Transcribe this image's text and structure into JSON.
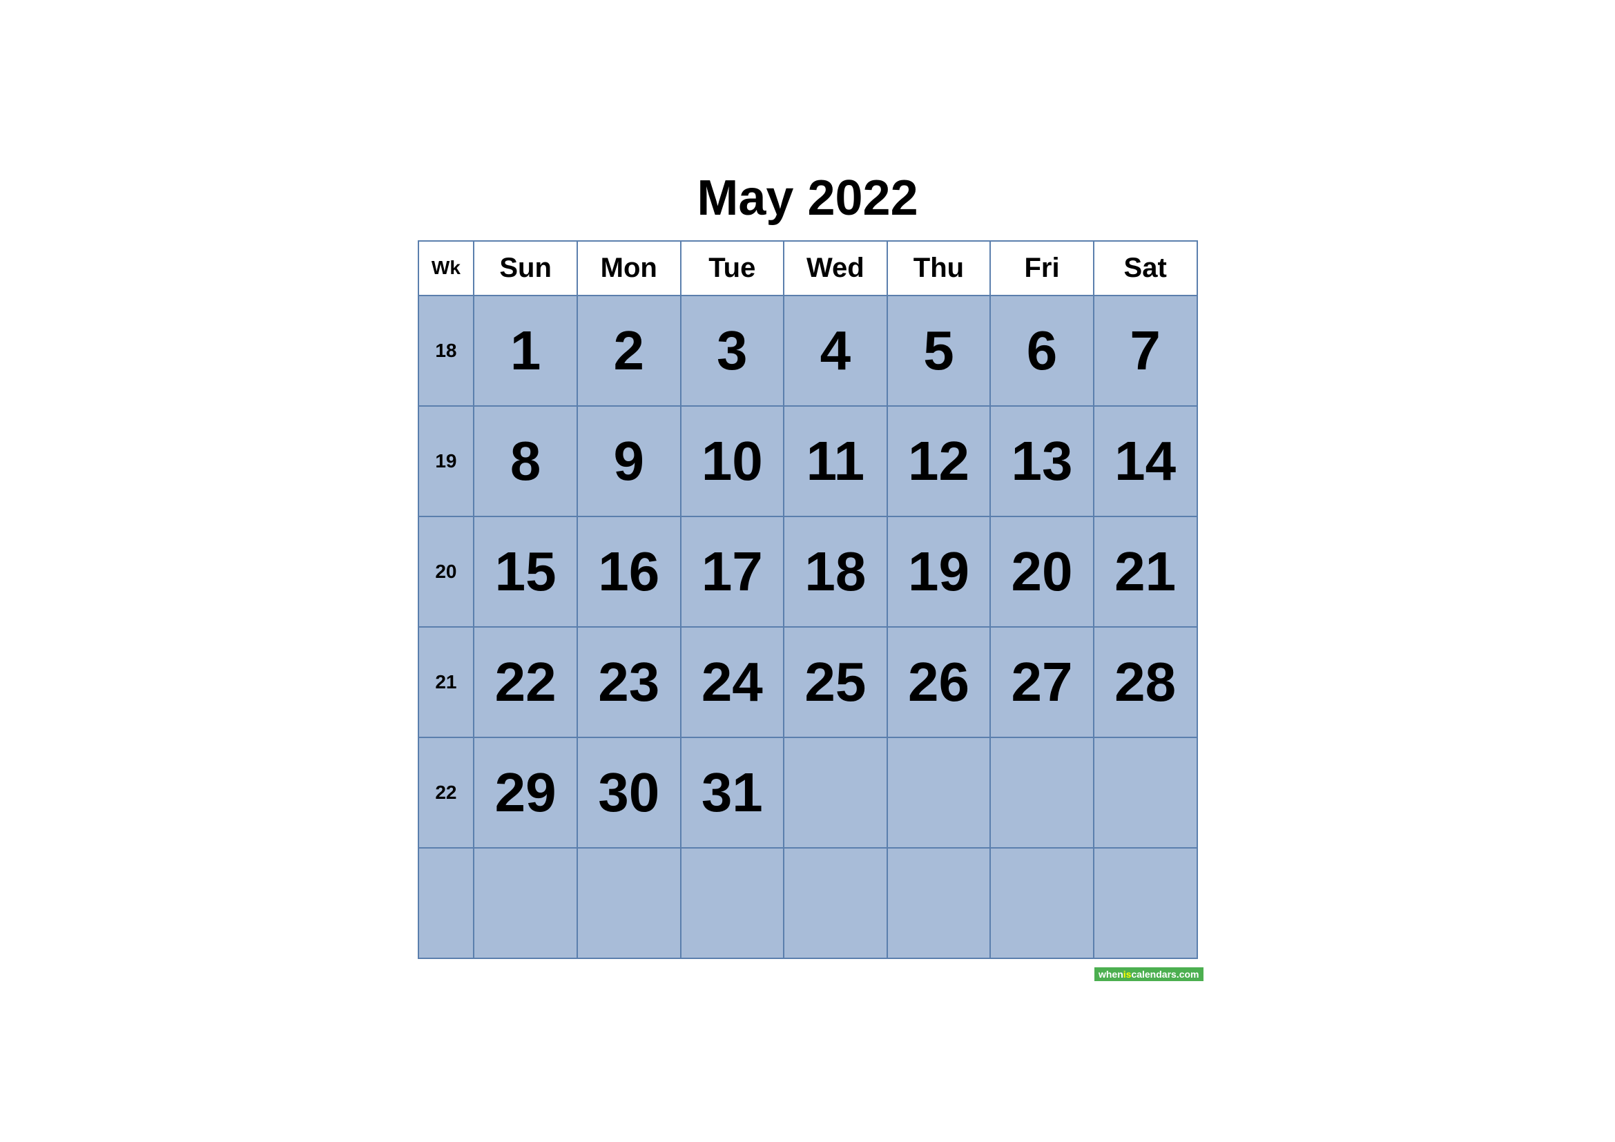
{
  "title": "May 2022",
  "colors": {
    "cell_bg": "#a8bcd8",
    "border": "#5b7fad",
    "text": "#000000",
    "white": "#ffffff"
  },
  "headers": {
    "wk": "Wk",
    "sun": "Sun",
    "mon": "Mon",
    "tue": "Tue",
    "wed": "Wed",
    "thu": "Thu",
    "fri": "Fri",
    "sat": "Sat"
  },
  "weeks": [
    {
      "wk": "18",
      "days": [
        "1",
        "2",
        "3",
        "4",
        "5",
        "6",
        "7"
      ]
    },
    {
      "wk": "19",
      "days": [
        "8",
        "9",
        "10",
        "11",
        "12",
        "13",
        "14"
      ]
    },
    {
      "wk": "20",
      "days": [
        "15",
        "16",
        "17",
        "18",
        "19",
        "20",
        "21"
      ]
    },
    {
      "wk": "21",
      "days": [
        "22",
        "23",
        "24",
        "25",
        "26",
        "27",
        "28"
      ]
    },
    {
      "wk": "22",
      "days": [
        "29",
        "30",
        "31",
        "",
        "",
        "",
        ""
      ]
    },
    {
      "wk": "",
      "days": [
        "",
        "",
        "",
        "",
        "",
        "",
        ""
      ]
    }
  ],
  "watermark": {
    "when": "when",
    "is": "is",
    "cal": "calendars.com"
  }
}
